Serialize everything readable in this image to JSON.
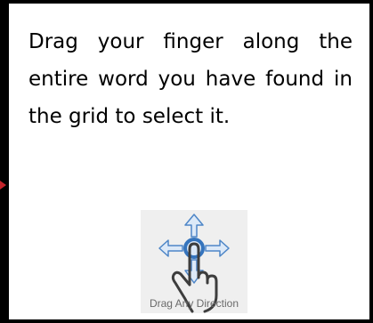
{
  "instruction": {
    "text": "Drag your finger along the entire word you have found in the grid to select it."
  },
  "gesture": {
    "icon": "drag-hand-icon",
    "caption": "Drag Any Direction"
  },
  "colors": {
    "border": "#000000",
    "arrow_fill": "#dce9f8",
    "arrow_stroke": "#4e86c7",
    "touch_point": "#3574bd",
    "marker": "#c4242b"
  }
}
